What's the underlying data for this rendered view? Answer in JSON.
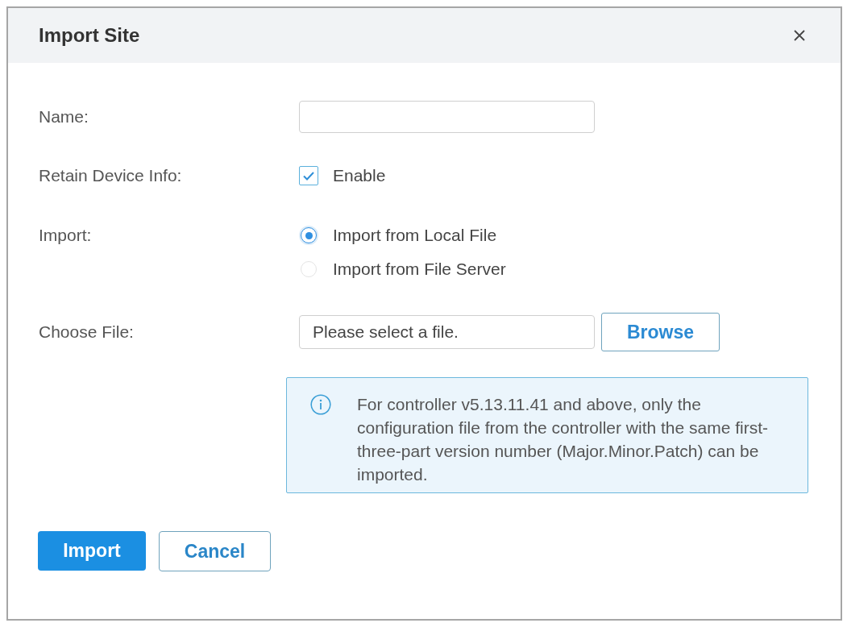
{
  "dialog": {
    "title": "Import Site"
  },
  "form": [
    {
      "kind": "text",
      "label": "Name:"
    },
    {
      "kind": "checkbox",
      "label": "Retain Device Info:",
      "option": "Enable",
      "checked": true
    },
    {
      "kind": "radio",
      "label": "Import:",
      "options": [
        {
          "label": "Import from Local File",
          "selected": true
        },
        {
          "label": "Import from File Server",
          "selected": false
        }
      ]
    },
    {
      "kind": "file",
      "label": "Choose File:",
      "placeholder": "Please select a file.",
      "button": "Browse"
    }
  ],
  "notice": {
    "text": "For controller v5.13.11.41 and above, only the configuration file from the controller with the same first-three-part version number (Major.Minor.Patch) can be imported."
  },
  "buttons": [
    {
      "label": "Import",
      "kind": "primary"
    },
    {
      "label": "Cancel",
      "kind": "secondary"
    }
  ]
}
